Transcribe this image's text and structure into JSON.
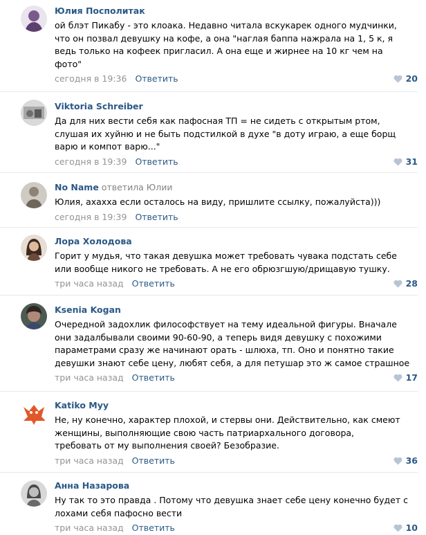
{
  "comments": [
    {
      "author": "Юлия Посполитак",
      "reply_to": "",
      "lines": [
        "ой блэт Пикабу - это клоака. Недавно читала вскукарек одного мудчинки,",
        "что он позвал девушку на кофе, а она \"наглая баппа нажрала на 1, 5 к, я",
        "ведь только на кофеек пригласил. А она еще и жирнее на 10 кг чем на",
        "фото\""
      ],
      "time": "сегодня в 19:36",
      "reply_label": "Ответить",
      "likes": "20",
      "avatar_color": "#7a5a8c"
    },
    {
      "author": "Viktoria Schreiber",
      "reply_to": "",
      "lines": [
        "Да для них вести себя как пафосная ТП = не сидеть с открытым ртом,",
        "слушая их хуйню и не быть подстилкой в духе \"в доту играю, а еще борщ",
        "варю и компот варю...\""
      ],
      "time": "сегодня в 19:39",
      "reply_label": "Ответить",
      "likes": "31",
      "avatar_color": "#8e8e8e"
    },
    {
      "author": "No Name",
      "reply_to": "ответила Юлии",
      "lines": [
        "Юлия, ахахха если осталось на виду, пришлите ссылку, пожалуйста)))"
      ],
      "time": "сегодня в 19:39",
      "reply_label": "Ответить",
      "likes": "",
      "avatar_color": "#b8b2a8"
    },
    {
      "author": "Лора Холодова",
      "reply_to": "",
      "lines": [
        "Горит у мудья, что такая девушка может требовать чувака подстать себе",
        "или вообще никого не требовать. А не его обрюзгшую/дрищавую тушку."
      ],
      "time": "три часа назад",
      "reply_label": "Ответить",
      "likes": "28",
      "avatar_color": "#6b4a3a"
    },
    {
      "author": "Ksenia Kogan",
      "reply_to": "",
      "lines": [
        "Очередной задохлик философствует на тему идеальной фигуры. Вначале",
        "они задалбывали своими 90-60-90, а теперь видя девушку с похожими",
        "параметрами сразу же начинают орать - шлюха, тп. Оно и понятно такие",
        "девушки знают себе цену, любят себя, а для петушар это ж самое страшное"
      ],
      "time": "три часа назад",
      "reply_label": "Ответить",
      "likes": "17",
      "avatar_color": "#5a4a42"
    },
    {
      "author": "Katiko Myy",
      "reply_to": "",
      "lines": [
        "Не, ну конечно, характер плохой, и стервы они. Действительно, как смеют",
        "женщины, выполняющие свою часть патриархального договора,",
        "требовать от му выполнения своей? Безобразие."
      ],
      "time": "три часа назад",
      "reply_label": "Ответить",
      "likes": "36",
      "avatar_color": "#e0582a"
    },
    {
      "author": "Анна Назарова",
      "reply_to": "",
      "lines": [
        "Ну так то это правда . Потому что девушка знает себе цену конечно будет с",
        "лохами себя пафосно вести"
      ],
      "time": "три часа назад",
      "reply_label": "Ответить",
      "likes": "10",
      "avatar_color": "#9a9a9a"
    }
  ],
  "colors": {
    "link": "#2a5885",
    "meta": "#939393",
    "like_heart": "#b7c4d4",
    "divider": "#e7e8ec"
  }
}
